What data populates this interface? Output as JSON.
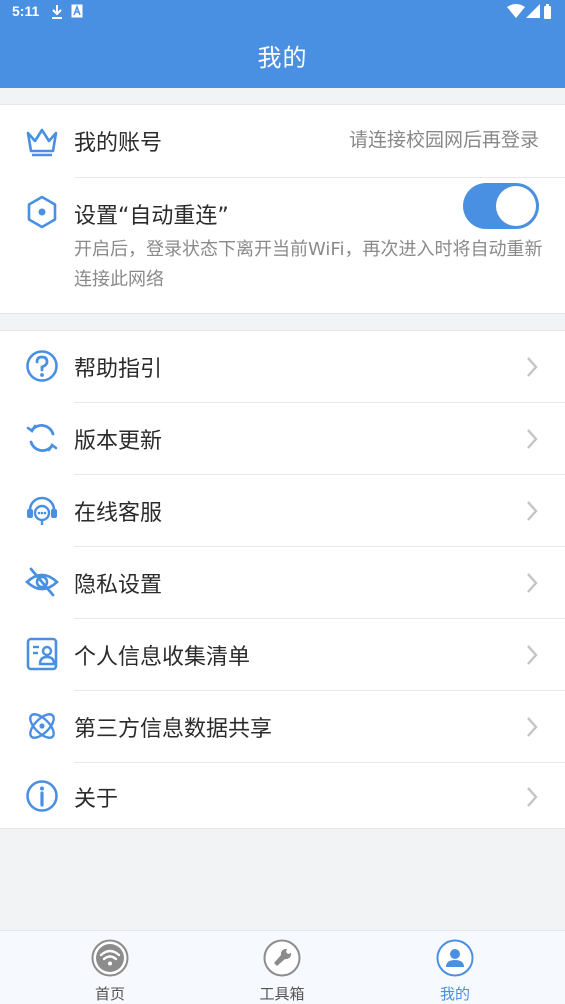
{
  "status_bar": {
    "time": "5:11"
  },
  "header": {
    "title": "我的"
  },
  "account": {
    "label": "我的账号",
    "hint": "请连接校园网后再登录",
    "icon": "crown-icon"
  },
  "auto_reconnect": {
    "label": "设置“自动重连”",
    "enabled": true,
    "description": "开启后，登录状态下离开当前WiFi，再次进入时将自动重新连接此网络",
    "icon": "hexagon-icon"
  },
  "menu": {
    "items": [
      {
        "label": "帮助指引",
        "icon": "help-icon"
      },
      {
        "label": "版本更新",
        "icon": "refresh-icon"
      },
      {
        "label": "在线客服",
        "icon": "headset-icon"
      },
      {
        "label": "隐私设置",
        "icon": "eye-off-icon"
      },
      {
        "label": "个人信息收集清单",
        "icon": "id-card-icon"
      },
      {
        "label": "第三方信息数据共享",
        "icon": "share-orbit-icon"
      },
      {
        "label": "关于",
        "icon": "info-icon"
      }
    ]
  },
  "tabbar": {
    "tabs": [
      {
        "label": "首页",
        "icon": "wifi-icon",
        "active": false
      },
      {
        "label": "工具箱",
        "icon": "wrench-icon",
        "active": false
      },
      {
        "label": "我的",
        "icon": "user-icon",
        "active": true
      }
    ]
  },
  "colors": {
    "accent": "#4a90e2",
    "background": "#f2f3f5"
  }
}
